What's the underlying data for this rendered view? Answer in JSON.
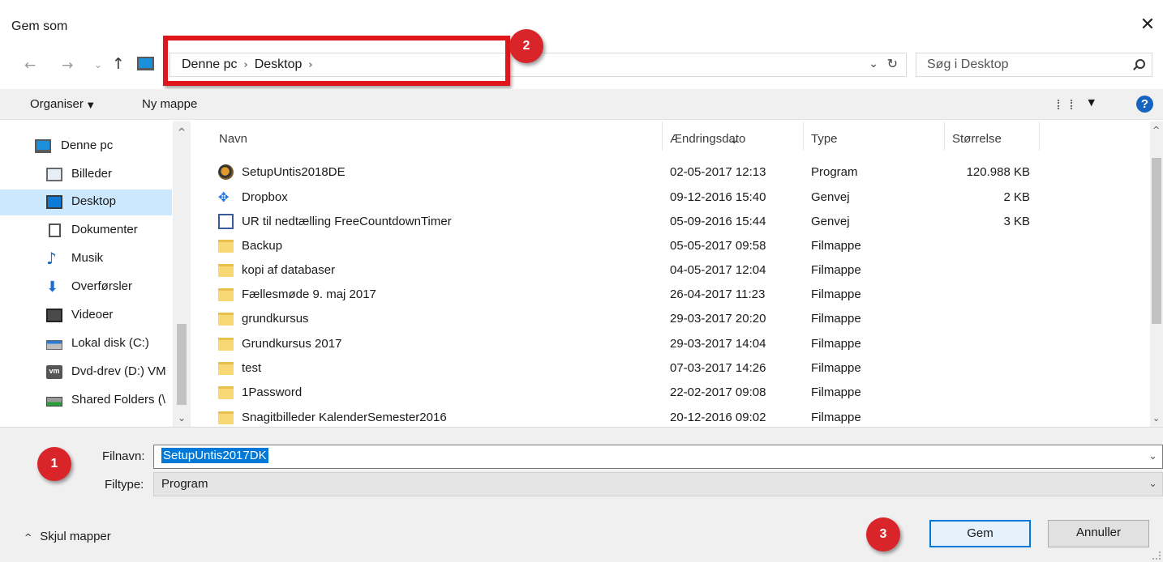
{
  "window": {
    "title": "Gem som",
    "close_glyph": "✕"
  },
  "nav": {
    "back_glyph": "←",
    "forward_glyph": "→",
    "recent_glyph": "⌄",
    "up_glyph": "↑",
    "breadcrumbs": [
      "Denne pc",
      "Desktop"
    ],
    "crumb_separator": "›",
    "address_dropdown_glyph": "⌄",
    "refresh_glyph": "↻",
    "search_placeholder": "Søg i Desktop"
  },
  "callouts": {
    "one": "1",
    "two": "2",
    "three": "3"
  },
  "toolbar": {
    "organize_label": "Organiser",
    "organize_caret": "▼",
    "new_folder_label": "Ny mappe",
    "views_caret": "▼",
    "help_label": "?"
  },
  "sidebar": {
    "scroll_up": "^",
    "scroll_down": "⌄",
    "items": [
      {
        "label": "Denne pc",
        "icon": "pc-icon"
      },
      {
        "label": "Billeder",
        "icon": "pictures-icon"
      },
      {
        "label": "Desktop",
        "icon": "desktop-icon",
        "selected": true
      },
      {
        "label": "Dokumenter",
        "icon": "documents-icon"
      },
      {
        "label": "Musik",
        "icon": "music-icon",
        "glyph": "♪"
      },
      {
        "label": "Overførsler",
        "icon": "downloads-icon",
        "glyph": "⬇"
      },
      {
        "label": "Videoer",
        "icon": "videos-icon"
      },
      {
        "label": "Lokal disk (C:)",
        "icon": "local-disk-icon"
      },
      {
        "label": "Dvd-drev (D:) VM",
        "icon": "dvd-drive-icon",
        "glyph": "vm"
      },
      {
        "label": "Shared Folders (\\",
        "icon": "shared-folders-icon"
      }
    ]
  },
  "filelist": {
    "columns": {
      "name": "Navn",
      "modified": "Ændringsdato",
      "type": "Type",
      "size": "Størrelse"
    },
    "sort_glyph": "⌄",
    "scroll_up": "^",
    "scroll_down": "⌄",
    "rows": [
      {
        "name": "SetupUntis2018DE",
        "modified": "02-05-2017 12:13",
        "type": "Program",
        "size": "120.988 KB",
        "icon": "setup-program-icon"
      },
      {
        "name": "Dropbox",
        "modified": "09-12-2016 15:40",
        "type": "Genvej",
        "size": "2 KB",
        "icon": "dropbox-icon",
        "glyph": "✥"
      },
      {
        "name": "UR til nedtælling FreeCountdownTimer",
        "modified": "05-09-2016 15:44",
        "type": "Genvej",
        "size": "3 KB",
        "icon": "timer-shortcut-icon"
      },
      {
        "name": "Backup",
        "modified": "05-05-2017 09:58",
        "type": "Filmappe",
        "size": "",
        "icon": "folder-icon"
      },
      {
        "name": "kopi af databaser",
        "modified": "04-05-2017 12:04",
        "type": "Filmappe",
        "size": "",
        "icon": "folder-icon"
      },
      {
        "name": "Fællesmøde 9. maj 2017",
        "modified": "26-04-2017 11:23",
        "type": "Filmappe",
        "size": "",
        "icon": "folder-icon"
      },
      {
        "name": "grundkursus",
        "modified": "29-03-2017 20:20",
        "type": "Filmappe",
        "size": "",
        "icon": "folder-icon"
      },
      {
        "name": "Grundkursus 2017",
        "modified": "29-03-2017 14:04",
        "type": "Filmappe",
        "size": "",
        "icon": "folder-icon"
      },
      {
        "name": "test",
        "modified": "07-03-2017 14:26",
        "type": "Filmappe",
        "size": "",
        "icon": "folder-icon"
      },
      {
        "name": "1Password",
        "modified": "22-02-2017 09:08",
        "type": "Filmappe",
        "size": "",
        "icon": "folder-icon"
      },
      {
        "name": "Snagitbilleder KalenderSemester2016",
        "modified": "20-12-2016 09:02",
        "type": "Filmappe",
        "size": "",
        "icon": "folder-icon"
      }
    ]
  },
  "form": {
    "filename_label": "Filnavn:",
    "filename_value": "SetupUntis2017DK",
    "filetype_label": "Filtype:",
    "filetype_value": "Program",
    "dropdown_glyph": "⌄"
  },
  "footer": {
    "hide_folders_label": "Skjul mapper",
    "hide_folders_glyph": "^",
    "save_label": "Gem",
    "cancel_label": "Annuller"
  },
  "colors": {
    "accent": "#0078d7",
    "callout": "#d9252a",
    "selection": "#cce8ff"
  }
}
